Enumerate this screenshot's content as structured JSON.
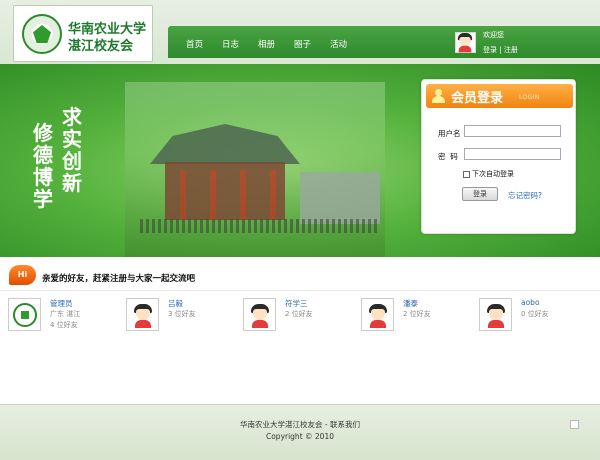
{
  "site": {
    "name_line1": "华南农业大学",
    "name_line2": "湛江校友会",
    "brand_color": "#2f8a2c",
    "logo_icon": "university-emblem-icon"
  },
  "nav": {
    "items": [
      "首页",
      "日志",
      "相册",
      "圈子",
      "活动"
    ],
    "welcome": "欢迎您",
    "login_link": "登录",
    "separator": "|",
    "register_link": "注册"
  },
  "banner": {
    "motto_col1": [
      "求",
      "实",
      "创",
      "新"
    ],
    "motto_col2": [
      "修",
      "德",
      "博",
      "学"
    ]
  },
  "login": {
    "title": "会员登录",
    "title_en": "LOGIN",
    "username_label": "用户名",
    "password_label": "密  码",
    "remember_label": "下次自动登录",
    "submit_label": "登录",
    "forgot_label": "忘记密码?",
    "accent_color": "#f08312"
  },
  "friends": {
    "badge": "Hi",
    "title": "亲爱的好友，赶紧注册与大家一起交流吧",
    "list": [
      {
        "name": "管理员",
        "line2": "广东 湛江",
        "line3": "4 位好友",
        "avatar": "university-emblem-icon"
      },
      {
        "name": "吕毅",
        "line2": "3 位好友",
        "line3": "",
        "avatar": "default-user-avatar-icon"
      },
      {
        "name": "符学三",
        "line2": "2 位好友",
        "line3": "",
        "avatar": "default-user-avatar-icon"
      },
      {
        "name": "潘泰",
        "line2": "2 位好友",
        "line3": "",
        "avatar": "default-user-avatar-icon"
      },
      {
        "name": "aobo",
        "line2": "0 位好友",
        "line3": "",
        "avatar": "default-user-avatar-icon"
      }
    ]
  },
  "footer": {
    "line1": "华南农业大学湛江校友会 - 联系我们",
    "copyright": "Copyright © 2010"
  }
}
